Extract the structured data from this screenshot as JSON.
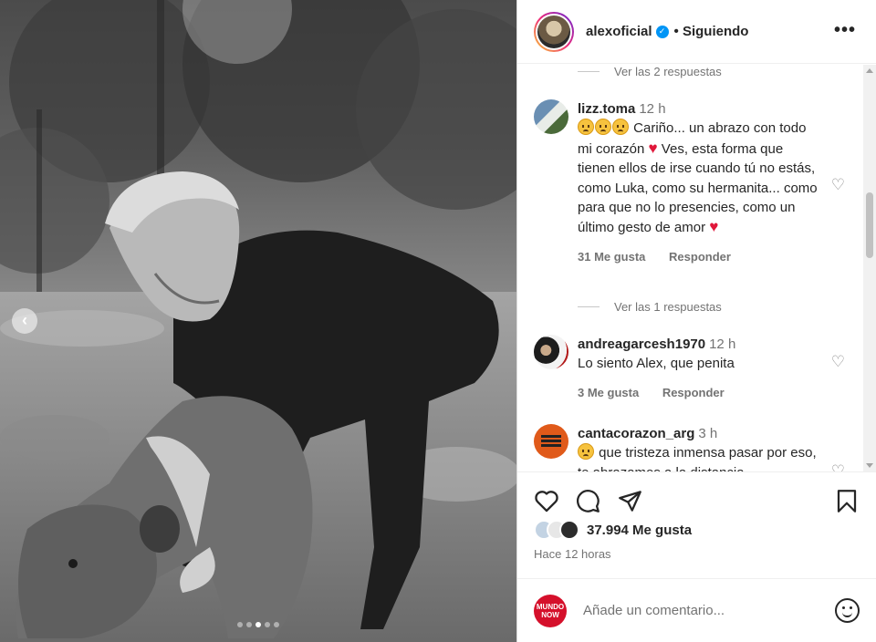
{
  "post": {
    "username": "alexoficial",
    "follow_state": "Siguiendo",
    "carousel": {
      "slides": 5,
      "active": 3
    }
  },
  "comments": [
    {
      "replies_label": "Ver las 2 respuestas"
    },
    {
      "username": "lizz.toma",
      "time": "12 h",
      "text": "Cariño... un abrazo con todo mi corazón",
      "text2": "Ves, esta forma que tienen ellos de irse cuando tú no estás, como Luka, como su hermanita... como para que no lo presencies, como un último gesto de amor",
      "likes": "31 Me gusta",
      "reply": "Responder",
      "replies_label": "Ver las 1 respuestas"
    },
    {
      "username": "andreagarcesh1970",
      "time": "12 h",
      "text": "Lo siento Alex, que penita",
      "likes": "3 Me gusta",
      "reply": "Responder"
    },
    {
      "username": "cantacorazon_arg",
      "time": "3 h",
      "text": "que tristeza inmensa pasar por eso, te abrazamos a la distancia"
    }
  ],
  "footer": {
    "likes_count": "37.994 Me gusta",
    "posted_ago": "Hace 12 horas",
    "comment_placeholder": "Añade un comentario...",
    "commenter_avatar_text": "MUNDO NOW"
  },
  "colors": {
    "verified": "#0095f6",
    "heart": "#e0173a",
    "story_ring": [
      "#f9ce34",
      "#ee2a7b",
      "#6228d7"
    ]
  },
  "icons": [
    "chevron-left-icon",
    "verified-badge-icon",
    "more-options-icon",
    "heart-icon",
    "comment-icon",
    "share-icon",
    "bookmark-icon",
    "emoji-icon"
  ]
}
